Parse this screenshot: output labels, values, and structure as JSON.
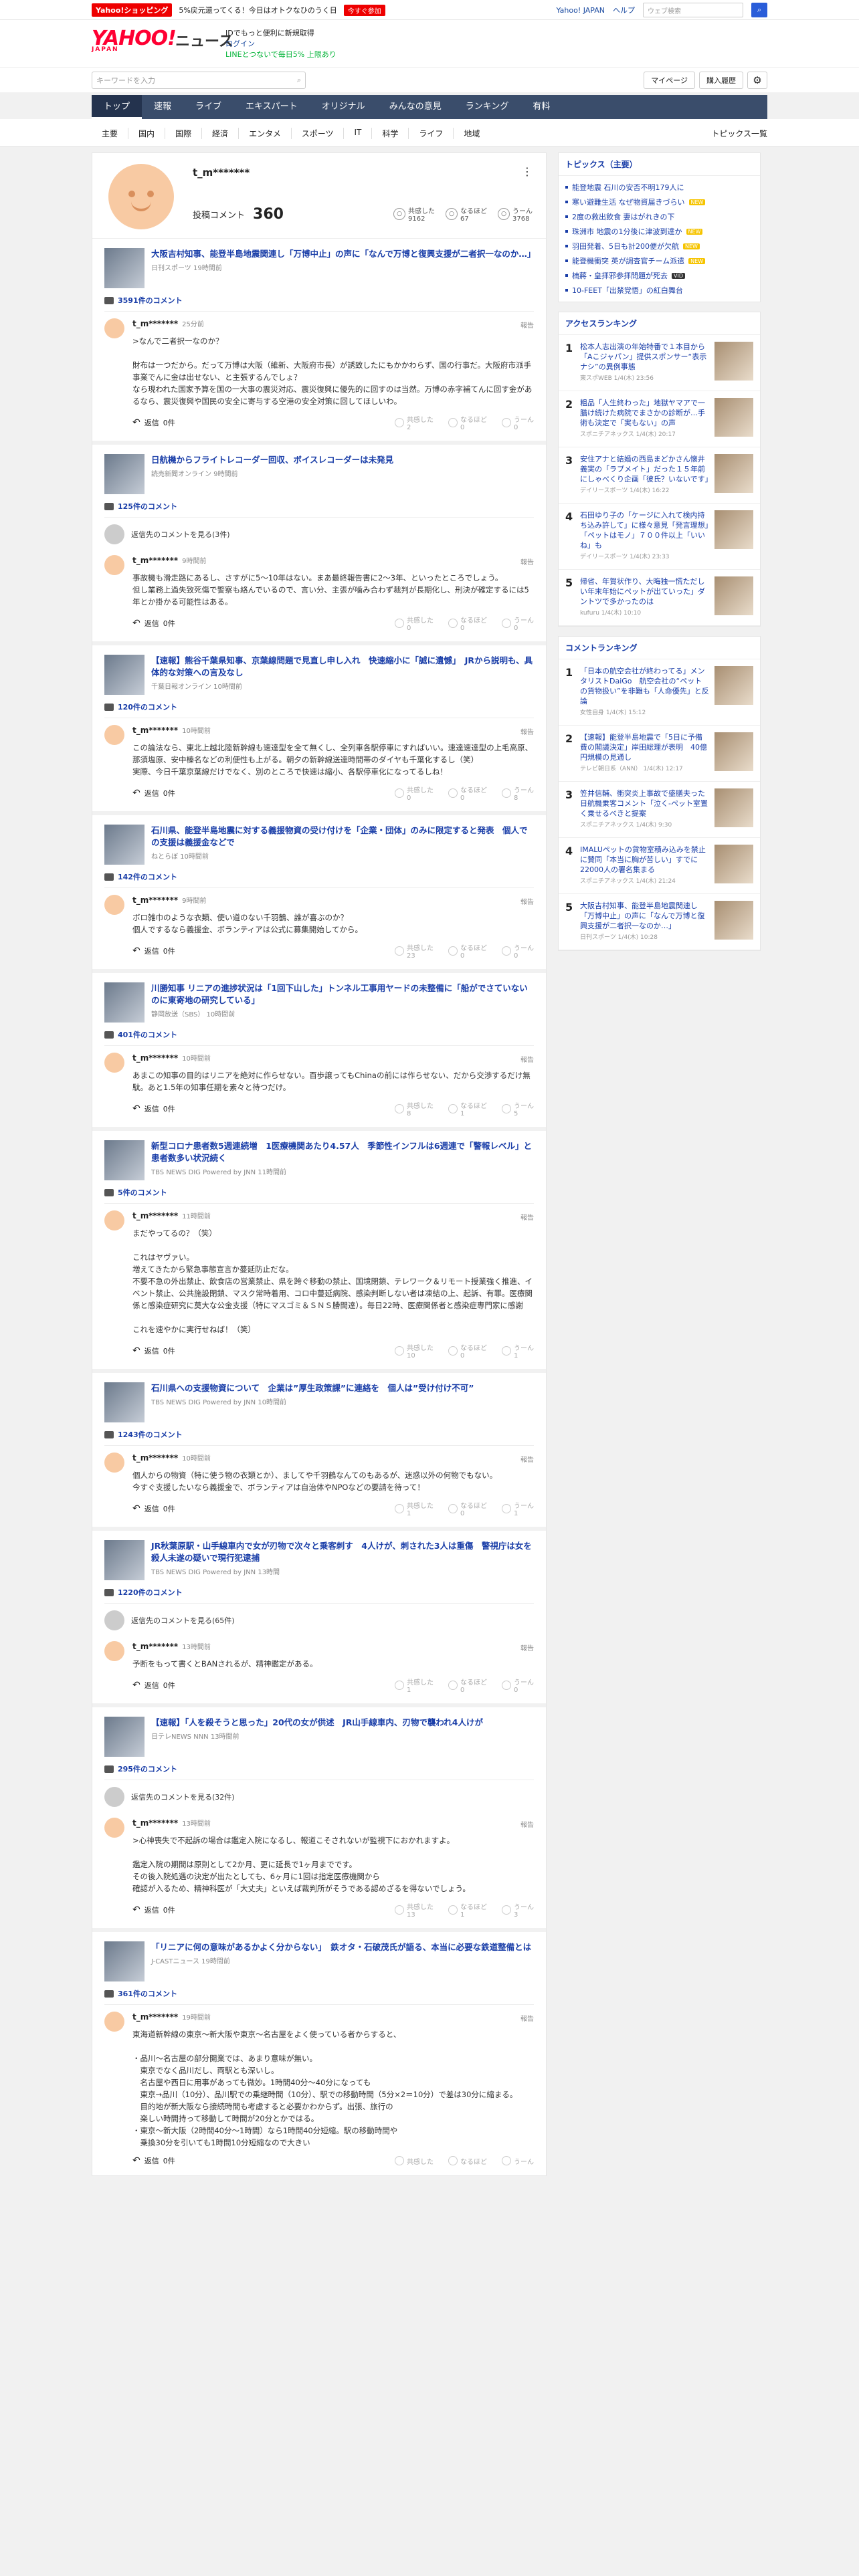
{
  "promo": {
    "shop": "Yahoo!ショッピング",
    "text": "5%戻元還ってくる！今日はオトクなひのうく日",
    "badge": "今すぐ参加",
    "links": [
      "Yahoo! JAPAN",
      "ヘルプ"
    ],
    "web_search_placeholder": "ウェブ検索"
  },
  "header": {
    "logo": "YAHOO!",
    "logo_sub": "JAPAN",
    "section": "ニュース",
    "id_line1": "IDでもっと便利に新規取得",
    "id_line2": "ログイン",
    "id_line3": "LINEとつないで毎日5% 上限あり"
  },
  "search": {
    "placeholder": "キーワードを入力",
    "mypage": "マイページ",
    "purchase": "購入履歴"
  },
  "nav1": [
    "トップ",
    "速報",
    "ライブ",
    "エキスパート",
    "オリジナル",
    "みんなの意見",
    "ランキング",
    "有料"
  ],
  "nav2": [
    "主要",
    "国内",
    "国際",
    "経済",
    "エンタメ",
    "スポーツ",
    "IT",
    "科学",
    "ライフ",
    "地域"
  ],
  "nav2_more": "トピックス一覧",
  "profile": {
    "name": "t_m*******",
    "label": "投稿コメント",
    "count": "360",
    "reactions": [
      {
        "label": "共感した",
        "value": "9162"
      },
      {
        "label": "なるほど",
        "value": "67"
      },
      {
        "label": "うーん",
        "value": "3768"
      }
    ]
  },
  "articles": [
    {
      "title": "大阪吉村知事、能登半島地震関連し「万博中止」の声に「なんで万博と復興支援が二者択一なのか…」",
      "source": "日刊スポーツ 19時間前",
      "comments": "3591件のコメント",
      "prev": "",
      "user": "t_m*******",
      "time": "25分前",
      "body": ">なんで二者択一なのか？\n\n財布は一つだから。だって万博は大阪（維新、大阪府市長）が誘致したにもかかわらず、国の行事だ。大阪府市派手事業でんに金は出せない、と主張するんでしょ？\nなら現われた国家予算を国の一大事の震災対応、震災復興に優先的に回すのは当然。万博の赤字補てんに回す金があるなら、震災復興や国民の安全に寄与する空港の安全対策に回してほしいわ。",
      "votes": [
        "2",
        "0",
        "0"
      ]
    },
    {
      "title": "日航機からフライトレコーダー回収、ボイスレコーダーは未発見",
      "source": "読売新聞オンライン 9時間前",
      "comments": "125件のコメント",
      "prev": "返信先のコメントを見る(3件)",
      "user": "t_m*******",
      "time": "9時間前",
      "body": "事故機も滑走路にあるし、さすがに5〜10年はない。まあ最終報告書に2〜3年、といったところでしょう。\n但し業務上過失致死傷で警察も絡んでいるので、言い分、主張が噛み合わず裁判が長期化し、刑決が確定するには5年とか掛かる可能性はある。",
      "votes": [
        "0",
        "0",
        "0"
      ]
    },
    {
      "title": "【速報】熊谷千葉県知事、京葉線問題で見直し申し入れ　快速縮小に「誠に遺憾」　JRから説明も、具体的な対策への言及なし",
      "source": "千葉日報オンライン 10時間前",
      "comments": "120件のコメント",
      "prev": "",
      "user": "t_m*******",
      "time": "10時間前",
      "body": "この論法なら、東北上越北陸新幹線も速達型を全て無くし、全列車各駅停車にすればいい。速達速達型の上毛高原、那須塩原、安中榛名などの利便性も上がる。朝夕の新幹線送達時間帯のダイヤも千葉化するし（笑）\n実際、今日千葉京葉線だけでなく、別のところで快速は縮小、各駅停車化になってるしね！",
      "votes": [
        "0",
        "0",
        "8"
      ]
    },
    {
      "title": "石川県、能登半島地震に対する義援物資の受け付けを「企業・団体」のみに限定すると発表　個人での支援は義援金などで",
      "source": "ねとらぼ 10時間前",
      "comments": "142件のコメント",
      "prev": "",
      "user": "t_m*******",
      "time": "9時間前",
      "body": "ボロ雑巾のような衣類、使い道のない千羽鶴、誰が喜ぶのか？\n個人でするなら義援金、ボランティアは公式に募集開始してから。",
      "votes": [
        "23",
        "0",
        "0"
      ]
    },
    {
      "title": "川勝知事 リニアの進捗状況は「1回下山した」トンネル工事用ヤードの未整備に「船がでさていないのに東寄地の研究している」",
      "source": "静岡放送（SBS） 10時間前",
      "comments": "401件のコメント",
      "prev": "",
      "user": "t_m*******",
      "time": "10時間前",
      "body": "あまこの知事の目的はリニアを絶対に作らせない。百歩譲ってもChinaの前には作らせない、だから交渉するだけ無駄。あと1.5年の知事任期を素々と待つだけ。",
      "votes": [
        "8",
        "1",
        "5"
      ]
    },
    {
      "title": "新型コロナ患者数5週連続増　1医療機関あたり4.57人　季節性インフルは6週連で「警報レベル」と患者数多い状況続く",
      "source": "TBS NEWS DIG Powered by JNN 11時間前",
      "comments": "5件のコメント",
      "prev": "",
      "user": "t_m*******",
      "time": "11時間前",
      "body": "まだやってるの？（笑）\n\nこれはヤヴァい。\n増えてきたから緊急事態宣言か蔓延防止だな。\n不要不急の外出禁止、飲食店の営業禁止、県を跨ぐ移動の禁止、国境閉鎖、テレワーク＆リモート授業強く推進、イベント禁止、公共施設閉鎖、マスク常時着用、コロ中蔓延病院、感染判断しない者は凍結の上、起訴、有罪。医療関係と感染症研究に莫大な公金支援（特にマスゴミ＆ＳＮＳ勝間達）。毎日22時、医療関係者と感染症専門家に感謝\n\nこれを速やかに実行せねば！（笑）",
      "votes": [
        "10",
        "0",
        "1"
      ]
    },
    {
      "title": "石川県への支援物資について　企業は”厚生政策課”に連絡を　個人は”受け付け不可”",
      "source": "TBS NEWS DIG Powered by JNN 10時間前",
      "comments": "1243件のコメント",
      "prev": "",
      "user": "t_m*******",
      "time": "10時間前",
      "body": "個人からの物資（特に使う物の衣類とか）、ましてや千羽鶴なんてのもあるが、迷惑以外の何物でもない。\n今すぐ支援したいなら義援金で、ボランティアは自治体やNPOなどの要請を待って！",
      "votes": [
        "1",
        "0",
        "1"
      ]
    },
    {
      "title": "JR秋葉原駅・山手線車内で女が刃物で次々と乗客刺す　4人けが、刺された3人は重傷　警視庁は女を殺人未遂の疑いで現行犯逮捕",
      "source": "TBS NEWS DIG Powered by JNN 13時間",
      "comments": "1220件のコメント",
      "prev": "返信先のコメントを見る(65件)",
      "user": "t_m*******",
      "time": "13時間前",
      "body": "予断をもって書くとBANされるが、精神鑑定がある。",
      "votes": [
        "1",
        "0",
        "0"
      ]
    },
    {
      "title": "【速報】「人を殺そうと思った」20代の女が供述　JR山手線車内、刃物で襲われ4人けが",
      "source": "日テレNEWS NNN 13時間前",
      "comments": "295件のコメント",
      "prev": "返信先のコメントを見る(32件)",
      "user": "t_m*******",
      "time": "13時間前",
      "body": ">心神喪失で不起訴の場合は鑑定入院になるし、報道こそされないが監視下におかれますよ。\n\n鑑定入院の期間は原則として2か月、更に延長で1ヶ月までです。\nその後入院処遇の決定が出たとしても、6ヶ月に1回は指定医療機関から\n確認が入るため、精神科医が「大丈夫」といえば裁判所がそうである認めざるを得ないでしょう。",
      "votes": [
        "13",
        "1",
        "3"
      ]
    },
    {
      "title": "「リニアに何の意味があるかよく分からない」　鉄オタ・石破茂氏が語る、本当に必要な鉄道整備とは",
      "source": "J-CASTニュース 19時間前",
      "comments": "361件のコメント",
      "prev": "",
      "user": "t_m*******",
      "time": "19時間前",
      "body": "東海道新幹線の東京〜新大阪や東京〜名古屋をよく使っている者からすると、\n\n・品川〜名古屋の部分開業では、あまり意味が無い。\n　東京でなく品川だし、両駅とも深いし。\n　名古屋や西日に用事があっても微妙。1時間40分〜40分になっても\n　東京→品川（10分）、品川駅での乗継時間（10分）、駅での移動時間（5分×2＝10分）で差は30分に縮まる。\n　目的地が新大阪なら接続時間も考慮すると必要かわからず。出張、旅行の\n　楽しい時間持って移動して時間が20分とかではる。\n・東京〜新大阪（2時間40分〜1時間）なら1時間40分短縮。駅の移動時間や\n　乗換30分を引いても1時間10分短縮なので大きい",
      "votes": [
        "",
        "",
        ""
      ]
    }
  ],
  "side": {
    "topics_title": "トピックス（主要）",
    "topics": [
      {
        "t": "能登地震 石川の安否不明179人に",
        "tag": ""
      },
      {
        "t": "寒い避難生活 なぜ物資届きづらい",
        "tag": "NEW"
      },
      {
        "t": "2度の救出飲食 妻はがれきの下",
        "tag": ""
      },
      {
        "t": "珠洲市 地震の1分後に津波到達か",
        "tag": "NEW"
      },
      {
        "t": "羽田発着、5日も計200便が欠航",
        "tag": "NEW"
      },
      {
        "t": "能登機衝突 英が調査官チーム派遣",
        "tag": "NEW"
      },
      {
        "t": "楠蔣・皇拝邪参拝問題が死去",
        "tag": "VID"
      },
      {
        "t": "10-FEET「出禁覚悟」の紅白舞台",
        "tag": ""
      }
    ],
    "access_title": "アクセスランキング",
    "access": [
      {
        "n": "1",
        "t": "松本人志出演の年始特番で１本目から「Aこジャパン」提供スポンサー“表示ナシ”の異例事態",
        "s": "東スポWEB 1/4(木) 23:56"
      },
      {
        "n": "2",
        "t": "粗品「人生終わった」地獄ヤマアで一膳け続けた病院でまさかの診断が…手術も決定で「実もない」の声",
        "s": "スポニチアネックス 1/4(木) 20:17"
      },
      {
        "n": "3",
        "t": "安住アナと結婚の西島まどかさん懐井義実の「ラプメイト」だった１５年前にしゃべくり企画「彼氏？いないです」",
        "s": "デイリースポーツ 1/4(木) 16:22"
      },
      {
        "n": "4",
        "t": "石田ゆり子の「ケージに入れて検内持ち込み許して」に様々意見「発言理想」「ペットはモノ」７００件以上「いいね」も",
        "s": "デイリースポーツ 1/4(木) 23:33"
      },
      {
        "n": "5",
        "t": "帰省、年賀状作り、大晦独一慌ただしい年末年始にペットが出ていった」ダントツで多かったのは",
        "s": "kufuru 1/4(木) 10:10"
      }
    ],
    "comment_title": "コメントランキング",
    "comment": [
      {
        "n": "1",
        "t": "「日本の航空会社が終わってる」メンタリストDaiGo　航空会社の“ペットの貨物扱い”を非難も「人命優先」と反論",
        "s": "女性自身 1/4(木) 15:12"
      },
      {
        "n": "2",
        "t": "【速報】能登半島地震で「5日に予備費の閣議決定」岸田総理が表明　40億円規模の見通し",
        "s": "テレビ朝日系（ANN） 1/4(木) 12:17"
      },
      {
        "n": "3",
        "t": "笠井信輔、衝突炎上事故で盛膳夫った日航機乗客コメント「泣く-ペット室置く乗せるべきと提案",
        "s": "スポニチアネックス 1/4(木) 9:30"
      },
      {
        "n": "4",
        "t": "IMALUペットの貨物室積み込みを禁止に賛同「本当に胸が苦しい」すでに22000人の署名集まる",
        "s": "スポニチアネックス 1/4(木) 21:24"
      },
      {
        "n": "5",
        "t": "大阪吉村知事、能登半島地震関連し「万博中止」の声に「なんで万博と復興支援が二者択一なのか…」",
        "s": "日刊スポーツ 1/4(木) 10:28"
      }
    ]
  },
  "labels": {
    "report": "報告",
    "reply": "返信",
    "reply_count": "0件",
    "v1": "共感した",
    "v2": "なるほど",
    "v3": "うーん"
  }
}
